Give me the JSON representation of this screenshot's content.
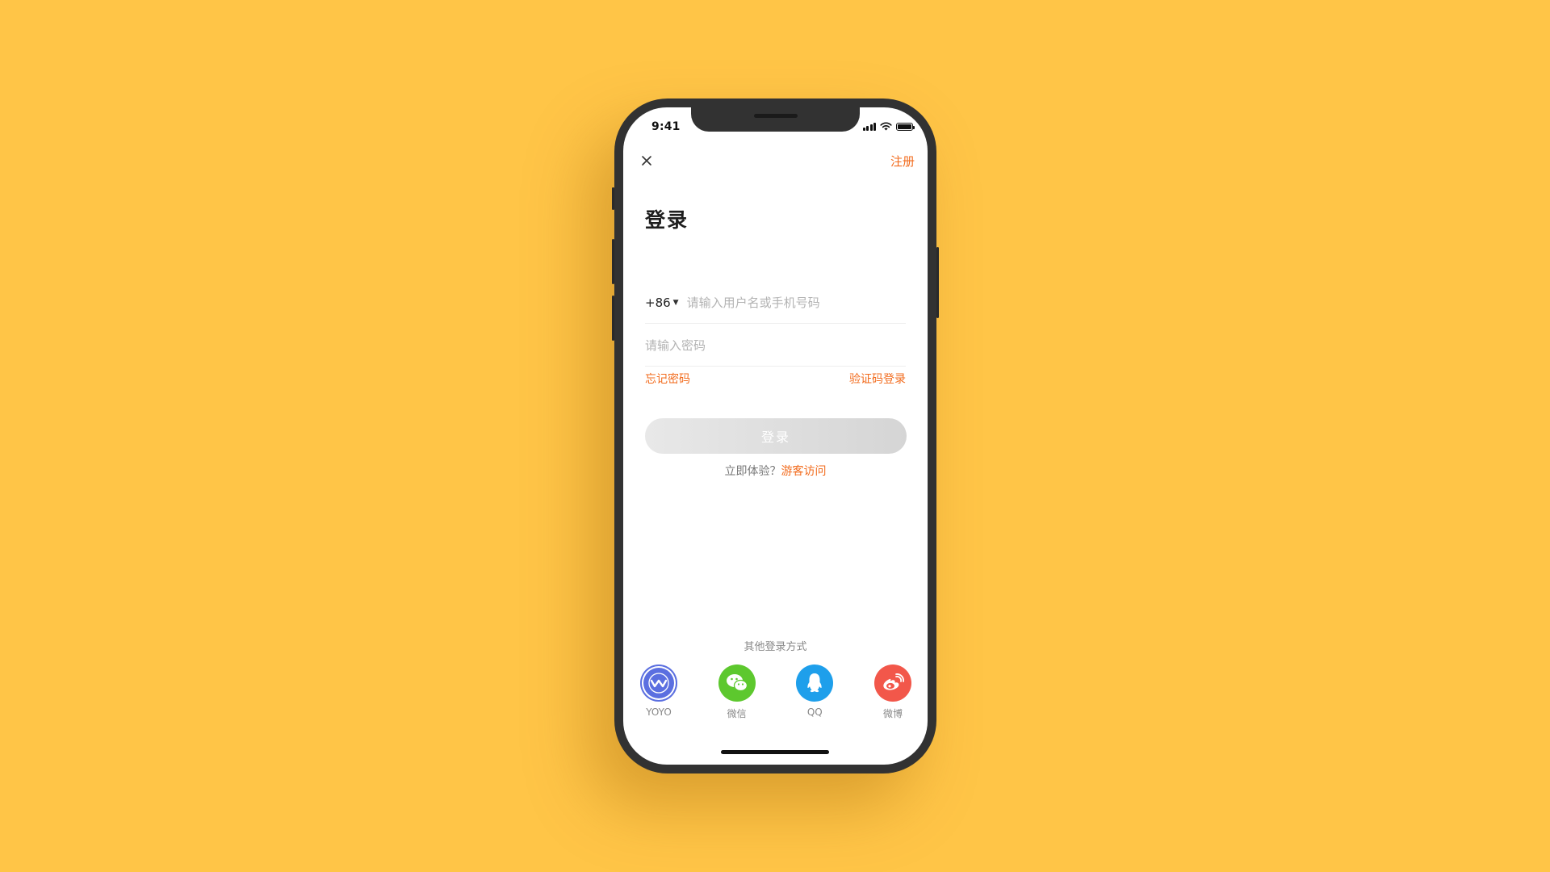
{
  "status_bar": {
    "time": "9:41"
  },
  "header": {
    "register_label": "注册"
  },
  "title": "登录",
  "phone_field": {
    "country_code": "+86",
    "placeholder": "请输入用户名或手机号码"
  },
  "password_field": {
    "placeholder": "请输入密码"
  },
  "links": {
    "forgot": "忘记密码",
    "sms_login": "验证码登录"
  },
  "login_button": "登录",
  "guest": {
    "prompt": "立即体验？",
    "action": "游客访问"
  },
  "other_login": {
    "title": "其他登录方式",
    "items": [
      {
        "label": "YOYO",
        "icon": "yoyo-icon",
        "color": "#5B6FE0"
      },
      {
        "label": "微信",
        "icon": "wechat-icon",
        "color": "#5DC82E"
      },
      {
        "label": "QQ",
        "icon": "qq-icon",
        "color": "#1E9FEB"
      },
      {
        "label": "微博",
        "icon": "weibo-icon",
        "color": "#F2574A"
      }
    ]
  },
  "colors": {
    "accent": "#F26B1D",
    "background": "#FFC547"
  }
}
